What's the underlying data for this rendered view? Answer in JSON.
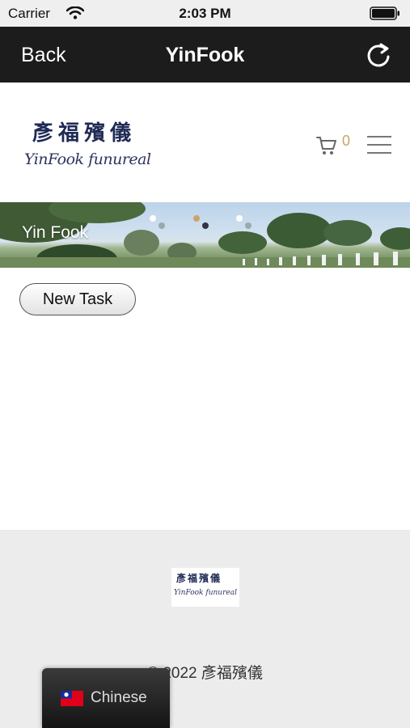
{
  "status_bar": {
    "carrier": "Carrier",
    "time": "2:03 PM"
  },
  "nav": {
    "back_label": "Back",
    "title": "YinFook"
  },
  "header": {
    "logo_cn": "彥福殯儀",
    "logo_en": "YinFook funureal",
    "cart_count": "0"
  },
  "banner": {
    "caption": "Yin Fook"
  },
  "main": {
    "new_task_label": "New Task"
  },
  "footer": {
    "logo_cn": "彥福殯儀",
    "logo_en": "YinFook funureal",
    "copyright": "© 2022 彥福殯儀"
  },
  "language": {
    "label": "Chinese"
  },
  "colors": {
    "nav_bg": "#1c1c1c",
    "cart_count": "#c9a46a",
    "footer_bg": "#ececec",
    "logo_navy": "#1f2a55"
  }
}
